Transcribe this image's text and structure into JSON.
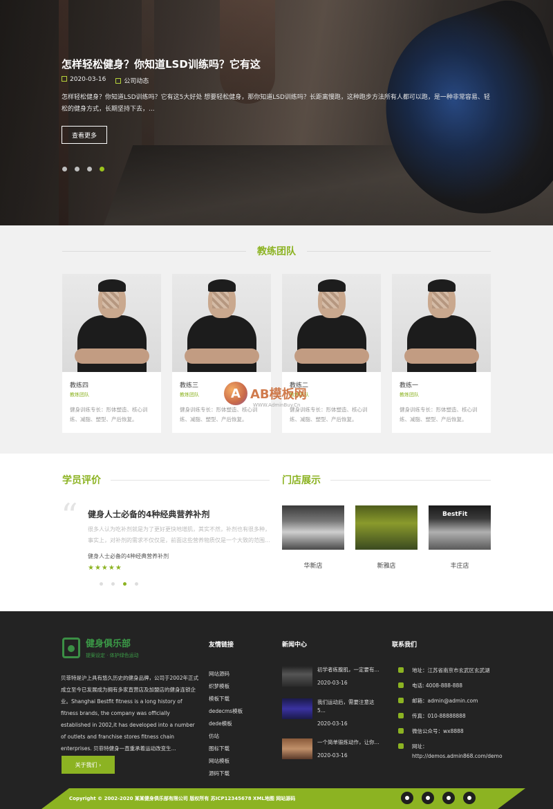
{
  "hero": {
    "title": "怎样轻松健身？你知道LSD训练吗？它有这",
    "date": "2020-03-16",
    "category": "公司动态",
    "desc": "怎样轻松健身？你知道LSD训练吗？它有这5大好处 想要轻松健身，那你知道LSD训练吗？长距离慢跑，这种跑步方法所有人都可以跑，是一种非常容易、轻松的健身方式，长期坚持下去，...",
    "button": "查看更多",
    "slides": 4,
    "active_slide": 4
  },
  "coach": {
    "title": "教练团队",
    "items": [
      {
        "name": "教练四",
        "role": "教练团队",
        "desc": "健身训练专长：形体塑造、核心训练、减脂、塑型、产后恢复。"
      },
      {
        "name": "教练三",
        "role": "教练团队",
        "desc": "健身训练专长：形体塑造、核心训练、减脂、塑型、产后恢复。"
      },
      {
        "name": "教练二",
        "role": "教练团队",
        "desc": "健身训练专长：形体塑造、核心训练、减脂、塑型、产后恢复。"
      },
      {
        "name": "教练一",
        "role": "教练团队",
        "desc": "健身训练专长：形体塑造、核心训练、减脂、塑型、产后恢复。"
      }
    ]
  },
  "watermark": {
    "mark": "A",
    "text": "AB模板网",
    "sub": "WWW.AdminBuy.Cn"
  },
  "review": {
    "title": "学员评价",
    "item_title": "健身人士必备的4种经典营养补剂",
    "text": "很多人认为吃补剂就是为了更好更快地增肌，其实不然，补剂也有很多种，事实上，对补剂的需求不仅仅是，前面这些营养物质仅是一个大致的范围...",
    "name": "健身人士必备的4种经典营养补剂",
    "stars": "★★★★★",
    "dots": 4,
    "active_dot": 3
  },
  "store": {
    "title": "门店展示",
    "items": [
      {
        "label": "华新店",
        "logo": ""
      },
      {
        "label": "新雅店",
        "logo": ""
      },
      {
        "label": "丰庄店",
        "logo": "BestFit"
      }
    ]
  },
  "footer": {
    "brand_title": "健身俱乐部",
    "brand_sub": "提案设定 · 体护绿色运动",
    "about": "贝菲特是沪上具有悠久历史的健身品牌，公司于2002年正式成立至今已发展成为拥有多家直营店及加盟店的健身连锁企业。Shanghai Bestfit fitness is a long history of fitness brands, the company was officially established in 2002,it has developed into a number of outlets and franchise stores fitness chain enterprises. 贝菲特健身一直重承着运动改变生...",
    "about_button": "关于我们 ›",
    "links_title": "友情链接",
    "links": [
      "网站源码",
      "织梦模板",
      "模板下载",
      "dedecms模板",
      "dede模板",
      "仿站",
      "图标下载",
      "网站模板",
      "源码下载"
    ],
    "news_title": "新闻中心",
    "news": [
      {
        "title": "初学者练腹肌，一定要有...",
        "date": "2020-03-16"
      },
      {
        "title": "我们运动后，需要注意这5...",
        "date": "2020-03-16"
      },
      {
        "title": "一个简单锻炼动作，让你...",
        "date": "2020-03-16"
      }
    ],
    "contact_title": "联系我们",
    "contact": [
      {
        "icon": "location-icon",
        "text": "地址：江苏省南京市玄武区玄武湖"
      },
      {
        "icon": "phone-icon",
        "text": "电话: 4008-888-888"
      },
      {
        "icon": "mail-icon",
        "text": "邮箱：admin@admin.com"
      },
      {
        "icon": "fax-icon",
        "text": "传真：010-88888888"
      },
      {
        "icon": "wechat-icon",
        "text": "微信公众号：wx8888"
      },
      {
        "icon": "home-icon",
        "text": "网址："
      },
      {
        "icon": "",
        "text": "http://demos.admin868.com/demo"
      }
    ],
    "copyright": "Copyright © 2002-2020 某某健身俱乐部有限公司 版权所有 苏ICP12345678 XML地图 网站源码",
    "socials": [
      "weibo-icon",
      "pinterest-icon",
      "chat-icon",
      "mobile-icon"
    ],
    "accent": "#8cb322"
  }
}
